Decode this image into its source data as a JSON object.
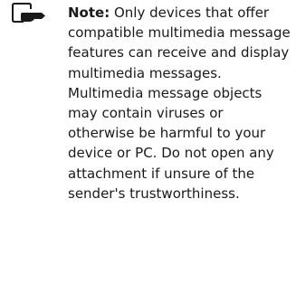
{
  "note": {
    "icon": "note-hand-icon",
    "label": "Note:",
    "body": "Only devices that offer compatible multimedia message features can receive and display multimedia messages. Multimedia message objects may contain viruses or otherwise be harmful to your device or PC. Do not open any attachment if unsure of the sender's trustworthiness."
  }
}
